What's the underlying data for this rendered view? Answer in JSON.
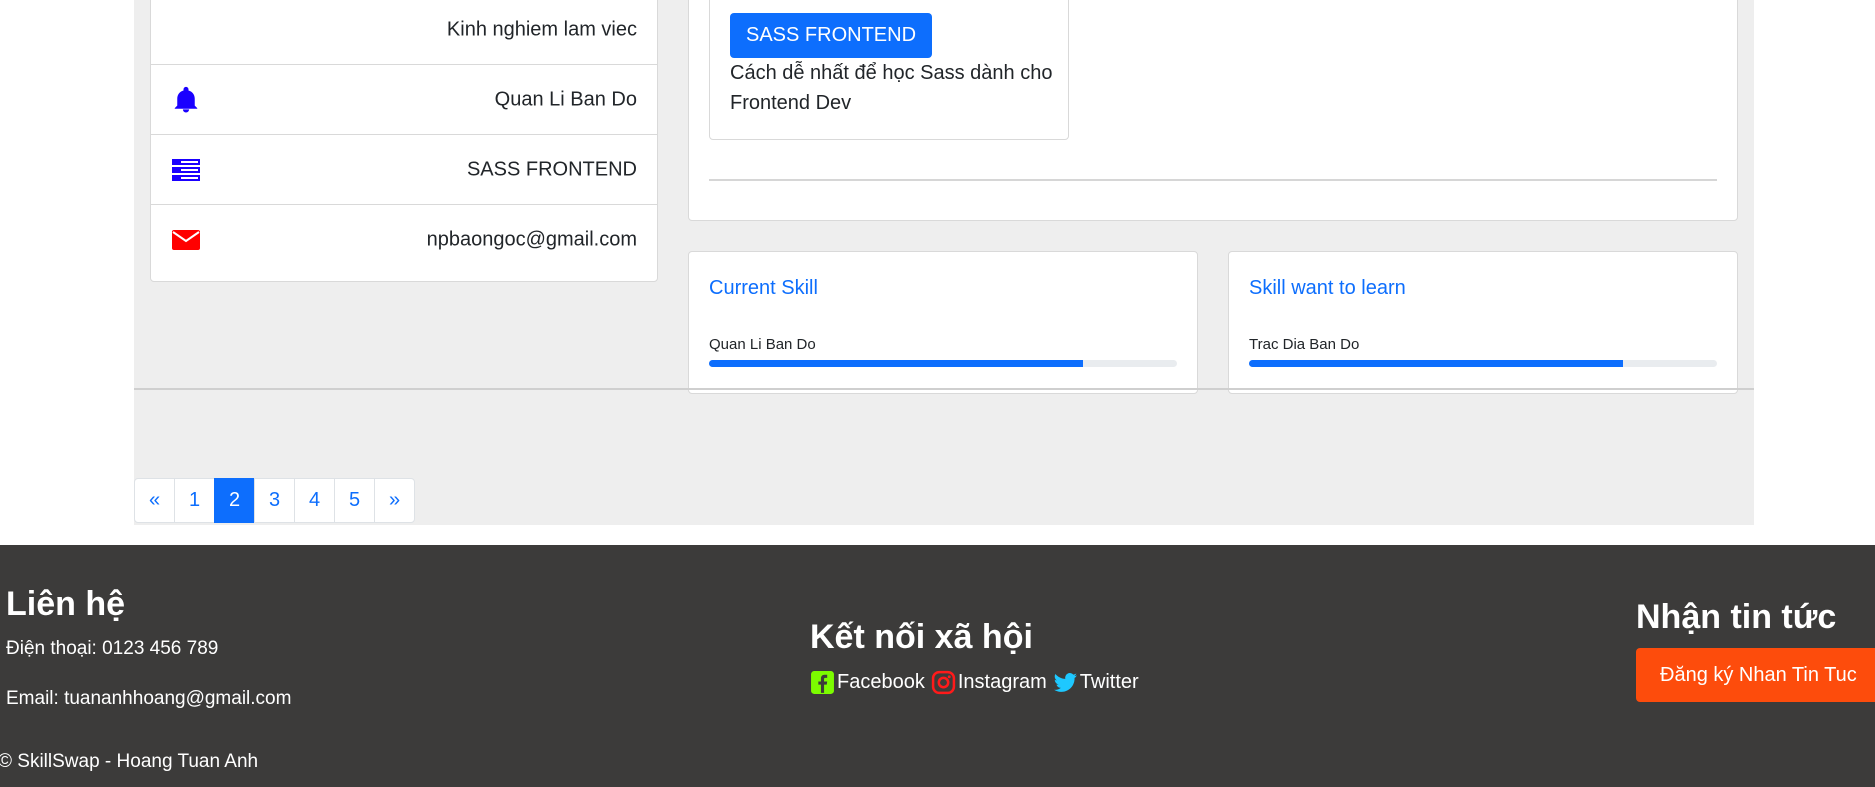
{
  "sidebar": {
    "items": [
      {
        "label": "Kinh nghiem lam viec",
        "icon": "none"
      },
      {
        "label": "Quan Li Ban Do",
        "icon": "bell-icon"
      },
      {
        "label": "SASS FRONTEND",
        "icon": "server-icon"
      },
      {
        "label": "npbaongoc@gmail.com",
        "icon": "envelope-icon"
      }
    ]
  },
  "course": {
    "button_label": "SASS FRONTEND",
    "description": "Cách dễ nhất để học Sass dành cho Frontend Dev"
  },
  "current_skill": {
    "title": "Current Skill",
    "skill_name": "Quan Li Ban Do",
    "progress_percent": 80
  },
  "learn_skill": {
    "title": "Skill want to learn",
    "skill_name": "Trac Dia Ban Do",
    "progress_percent": 80
  },
  "pagination": {
    "prev": "«",
    "pages": [
      "1",
      "2",
      "3",
      "4",
      "5"
    ],
    "active": "2",
    "next": "»"
  },
  "footer": {
    "contact": {
      "heading": "Liên hệ",
      "phone": "Điện thoại: 0123 456 789",
      "email": "Email: tuananhhoang@gmail.com"
    },
    "social": {
      "heading": "Kết nối xã hội",
      "facebook": "Facebook",
      "instagram": "Instagram",
      "twitter": "Twitter"
    },
    "newsletter": {
      "heading": "Nhận tin tức",
      "button_label": "Đăng ký Nhan Tin Tuc"
    },
    "copyright": "© SkillSwap - Hoang Tuan Anh"
  },
  "colors": {
    "primary": "#0d6efd",
    "footer_bg": "#3c3b3a",
    "subscribe_button": "#fd4c0c",
    "bell_icon": "#1a00ff",
    "envelope_icon": "#ff0000",
    "facebook_icon": "#7cfc00",
    "instagram_icon": "#ff1a1a",
    "twitter_icon": "#1ec8ff"
  }
}
